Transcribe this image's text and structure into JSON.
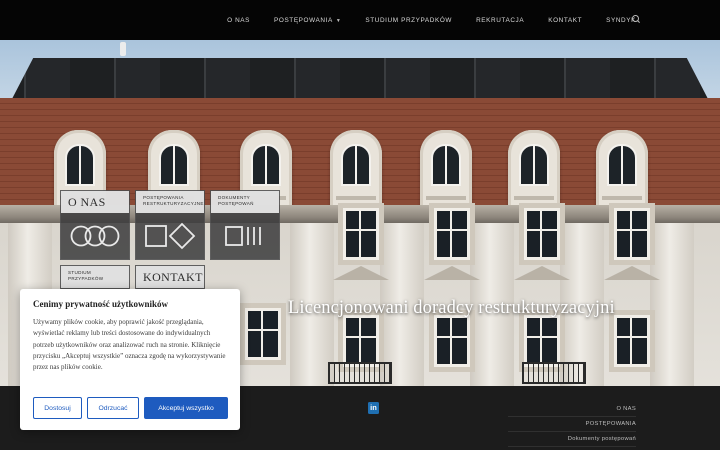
{
  "nav": {
    "items": [
      {
        "label": "O NAS"
      },
      {
        "label": "POSTĘPOWANIA",
        "has_dropdown": true
      },
      {
        "label": "STUDIUM PRZYPADKÓW"
      },
      {
        "label": "REKRUTACJA"
      },
      {
        "label": "KONTAKT"
      },
      {
        "label": "SYNDYK"
      }
    ],
    "search_icon": "search-icon"
  },
  "hero": {
    "title": "Licencjonowani doradcy restrukturyzacyjni"
  },
  "tiles": [
    {
      "label": "O NAS",
      "icon": "three-rings-icon"
    },
    {
      "label": "POSTĘPOWANIA RESTRUKTURYZACYJNE",
      "icon": "square-diamond-icon"
    },
    {
      "label": "DOKUMENTY POSTĘPOWAŃ",
      "icon": "bars-icon"
    },
    {
      "label": "STUDIUM PRZYPADKÓW",
      "icon": ""
    },
    {
      "label": "KONTAKT",
      "icon": ""
    }
  ],
  "footer": {
    "social_icon": "linkedin-icon",
    "social_letter": "in",
    "links": [
      {
        "label": "O NAS"
      },
      {
        "label": "POSTĘPOWANIA"
      },
      {
        "label": "Dokumenty postępowań"
      }
    ]
  },
  "cookie": {
    "title": "Cenimy prywatność użytkowników",
    "text": "Używamy plików cookie, aby poprawić jakość przeglądania, wyświetlać reklamy lub treści dostosowane do indywidualnych potrzeb użytkowników oraz analizować ruch na stronie. Kliknięcie przycisku „Akceptuj wszystkie” oznacza zgodę na wykorzystywanie przez nas plików cookie.",
    "buttons": {
      "customize": "Dostosuj",
      "reject": "Odrzucać",
      "accept": "Akceptuj wszystko"
    }
  },
  "colors": {
    "topbar": "#050505",
    "accent_blue": "#1e5bbf",
    "footer_bg": "#1c1c1c",
    "tile_bg": "#3c3c3e"
  }
}
